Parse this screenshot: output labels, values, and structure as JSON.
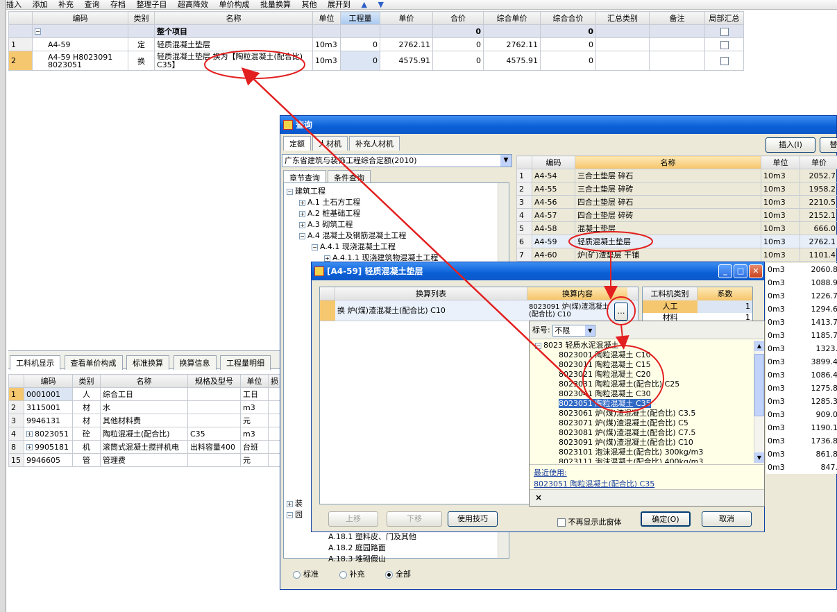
{
  "toolbar": {
    "items": [
      "插入",
      "添加",
      "补充",
      "查询",
      "存档",
      "整理子目",
      "超高降效",
      "单价构成",
      "批量换算",
      "其他",
      "展开到"
    ]
  },
  "main_table": {
    "headers": [
      "编码",
      "类别",
      "名称",
      "单位",
      "工程量",
      "单价",
      "合价",
      "综合单价",
      "综合合价",
      "汇总类别",
      "备注",
      "局部汇总"
    ],
    "group": {
      "name": "整个项目",
      "hj": "0",
      "zhhj": "0"
    },
    "rows": [
      {
        "no": "1",
        "code": "A4-59",
        "type": "定",
        "name": "轻质混凝土垫层",
        "unit": "10m3",
        "qty": "0",
        "price": "2762.11",
        "total": "0",
        "uprice": "2762.11",
        "utotal": "0"
      },
      {
        "no": "2",
        "code": "A4-59 H8023091 8023051",
        "type": "换",
        "name": "轻质混凝土垫层 换为【陶粒混凝土(配合比) C35】",
        "unit": "10m3",
        "qty": "0",
        "price": "4575.91",
        "total": "0",
        "uprice": "4575.91",
        "utotal": "0"
      }
    ]
  },
  "bottom_tabs": [
    "工料机显示",
    "查看单价构成",
    "标准换算",
    "换算信息",
    "工程量明细"
  ],
  "bottom_table": {
    "headers": [
      "编码",
      "类别",
      "名称",
      "规格及型号",
      "单位",
      "损"
    ],
    "rows": [
      {
        "no": "1",
        "code": "0001001",
        "type": "人",
        "name": "综合工日",
        "spec": "",
        "unit": "工日"
      },
      {
        "no": "2",
        "code": "3115001",
        "type": "材",
        "name": "水",
        "spec": "",
        "unit": "m3"
      },
      {
        "no": "3",
        "code": "9946131",
        "type": "材",
        "name": "其他材料费",
        "spec": "",
        "unit": "元"
      },
      {
        "no": "4",
        "code": "8023051",
        "type": "砼",
        "name": "陶粒混凝土(配合比)",
        "spec": "C35",
        "unit": "m3"
      },
      {
        "no": "8",
        "code": "9905181",
        "type": "机",
        "name": "滚筒式混凝土搅拌机电",
        "spec": "出料容量400",
        "unit": "台班"
      },
      {
        "no": "15",
        "code": "9946605",
        "type": "管",
        "name": "管理费",
        "spec": "",
        "unit": "元"
      }
    ]
  },
  "query": {
    "title": "查询",
    "tabs": [
      "定额",
      "人材机",
      "补充人材机"
    ],
    "buttons": {
      "insert": "插入(I)",
      "replace": "替"
    },
    "library": "广东省建筑与装饰工程综合定额(2010)",
    "subtabs": [
      "章节查询",
      "条件查询"
    ],
    "tree_top": [
      "建筑工程",
      "A.1 土石方工程",
      "A.2 桩基础工程",
      "A.3 砌筑工程",
      "A.4 混凝土及钢筋混凝土工程",
      "A.4.1 现浇混凝土工程",
      "A.4.1.1 现浇建筑物混凝土工程"
    ],
    "tree_bottom": [
      "装",
      "园",
      "A.18.1 塑料皮、门及其他",
      "A.18.2 庭园路面",
      "A.18.3 堆砌假山"
    ],
    "radios": [
      "标准",
      "补充",
      "全部"
    ],
    "headers": [
      "编码",
      "名称",
      "单位",
      "单价"
    ],
    "rows": [
      {
        "no": "1",
        "code": "A4-54",
        "name": "三合土垫层 碎石",
        "unit": "10m3",
        "price": "2052.7"
      },
      {
        "no": "2",
        "code": "A4-55",
        "name": "三合土垫层 碎砖",
        "unit": "10m3",
        "price": "1958.2"
      },
      {
        "no": "3",
        "code": "A4-56",
        "name": "四合土垫层 碎石",
        "unit": "10m3",
        "price": "2210.5"
      },
      {
        "no": "4",
        "code": "A4-57",
        "name": "四合土垫层 碎砖",
        "unit": "10m3",
        "price": "2152.1"
      },
      {
        "no": "5",
        "code": "A4-58",
        "name": "混凝土垫层",
        "unit": "10m3",
        "price": "666.0"
      },
      {
        "no": "6",
        "code": "A4-59",
        "name": "轻质混凝土垫层",
        "unit": "10m3",
        "price": "2762.1"
      },
      {
        "no": "7",
        "code": "A4-60",
        "name": "炉(矿)渣垫层 干铺",
        "unit": "10m3",
        "price": "1101.4"
      }
    ],
    "more_units": [
      {
        "u": "0m3",
        "p": "2060.8"
      },
      {
        "u": "0m3",
        "p": "1088.9"
      },
      {
        "u": "0m3",
        "p": "1226.7"
      },
      {
        "u": "0m3",
        "p": "1294.6"
      },
      {
        "u": "0m3",
        "p": "1413.7"
      },
      {
        "u": "0m3",
        "p": "1185.7"
      },
      {
        "u": "0m3",
        "p": "1323."
      },
      {
        "u": "0m3",
        "p": "3899.4"
      },
      {
        "u": "0m3",
        "p": "1086.4"
      },
      {
        "u": "0m3",
        "p": "1275.8"
      },
      {
        "u": "0m3",
        "p": "1285.3"
      },
      {
        "u": "0m3",
        "p": "909.0"
      },
      {
        "u": "0m3",
        "p": "1190.1"
      },
      {
        "u": "0m3",
        "p": "1736.8"
      },
      {
        "u": "0m3",
        "p": "861.8"
      },
      {
        "u": "0m3",
        "p": "847."
      }
    ]
  },
  "dialog": {
    "title": "[A4-59]  轻质混凝土垫层",
    "col1": "换算列表",
    "col2": "换算内容",
    "row_text": "换 炉(煤)渣混凝土(配合比) C10",
    "row_content": "8023091 炉(煤)渣混凝土(配合比) C10",
    "ellipsis": "…",
    "gl_headers": [
      "工料机类别",
      "系数"
    ],
    "gl_rows": [
      {
        "name": "人工",
        "val": "1"
      },
      {
        "name": "材料",
        "val": "1"
      }
    ],
    "btn_up": "上移",
    "btn_down": "下移",
    "btn_tips": "使用技巧",
    "no_show": "不再显示此窗体",
    "ok": "确定(O)",
    "cancel": "取消"
  },
  "dropdown": {
    "label": "标号:",
    "value": "不限",
    "group": "8023 轻质水泥混凝土",
    "items": [
      "8023001 陶粒混凝土 C10",
      "8023011 陶粒混凝土 C15",
      "8023021 陶粒混凝土 C20",
      "8023031 陶粒混凝土(配合比) C25",
      "8023041 陶粒混凝土 C30",
      "8023051 陶粒混凝土 C35",
      "8023061 炉(煤)渣混凝土(配合比) C3.5",
      "8023071 炉(煤)渣混凝土(配合比) C5",
      "8023081 炉(煤)渣混凝土(配合比) C7.5",
      "8023091 炉(煤)渣混凝土(配合比) C10",
      "8023101 泡沫混凝土(配合比) 300kg/m3",
      "8023111 泡沫混凝土(配合比) 400kg/m3"
    ],
    "selected": 5,
    "recent_label": "最近使用:",
    "recent_value": "8023051 陶粒混凝土(配合比) C35",
    "close": "×"
  }
}
